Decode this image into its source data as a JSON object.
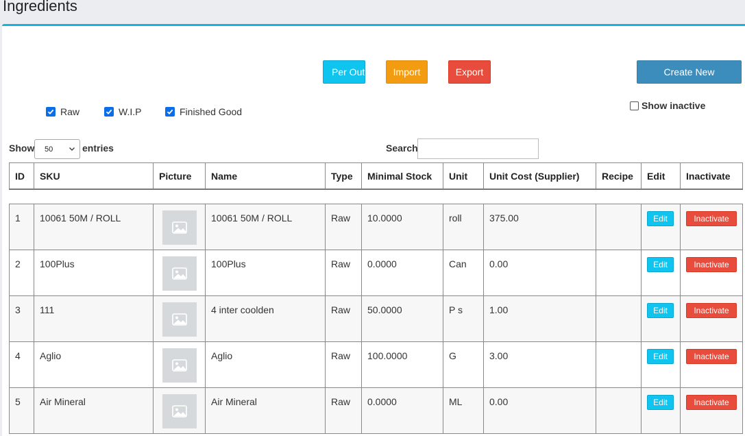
{
  "page": {
    "title": "Ingredients"
  },
  "toolbar": {
    "per_outlet_label": "Per Outlet",
    "import_label": "Import",
    "export_label": "Export",
    "create_label": "Create New"
  },
  "filters": {
    "raw": "Raw",
    "wip": "W.I.P",
    "finished": "Finished Good",
    "show_inactive": "Show inactive"
  },
  "length": {
    "show": "Show",
    "value": "50",
    "entries": "entries"
  },
  "search": {
    "label": "Search:",
    "value": ""
  },
  "table": {
    "headers": [
      "ID",
      "SKU",
      "Picture",
      "Name",
      "Type",
      "Minimal Stock",
      "Unit",
      "Unit Cost (Supplier)",
      "Recipe",
      "Edit",
      "Inactivate"
    ],
    "rows": [
      {
        "id": "1",
        "sku": "10061 50M / ROLL",
        "name": "10061 50M / ROLL",
        "type": "Raw",
        "min_stock": "10.0000",
        "unit": "roll",
        "cost": "375.00",
        "edit": "Edit",
        "inactivate": "Inactivate"
      },
      {
        "id": "2",
        "sku": "100Plus",
        "name": "100Plus",
        "type": "Raw",
        "min_stock": "0.0000",
        "unit": "Can",
        "cost": "0.00",
        "edit": "Edit",
        "inactivate": "Inactivate"
      },
      {
        "id": "3",
        "sku": "111",
        "name": "4 inter coolden",
        "type": "Raw",
        "min_stock": "50.0000",
        "unit": "P s",
        "cost": "1.00",
        "edit": "Edit",
        "inactivate": "Inactivate"
      },
      {
        "id": "4",
        "sku": "Aglio",
        "name": "Aglio",
        "type": "Raw",
        "min_stock": "100.0000",
        "unit": "G",
        "cost": "3.00",
        "edit": "Edit",
        "inactivate": "Inactivate"
      },
      {
        "id": "5",
        "sku": "Air Mineral",
        "name": "Air Mineral",
        "type": "Raw",
        "min_stock": "0.0000",
        "unit": "ML",
        "cost": "0.00",
        "edit": "Edit",
        "inactivate": "Inactivate"
      }
    ]
  },
  "icons": {
    "checkbox": "check-icon",
    "picture": "image-placeholder-icon",
    "select": "chevron-down-icon"
  },
  "colors": {
    "accent": "#17b3dd",
    "info": "#10c4f0",
    "warning": "#f39c12",
    "danger": "#e74c3c",
    "primary": "#3c8dbc",
    "checkbox": "#0b6ee8"
  }
}
